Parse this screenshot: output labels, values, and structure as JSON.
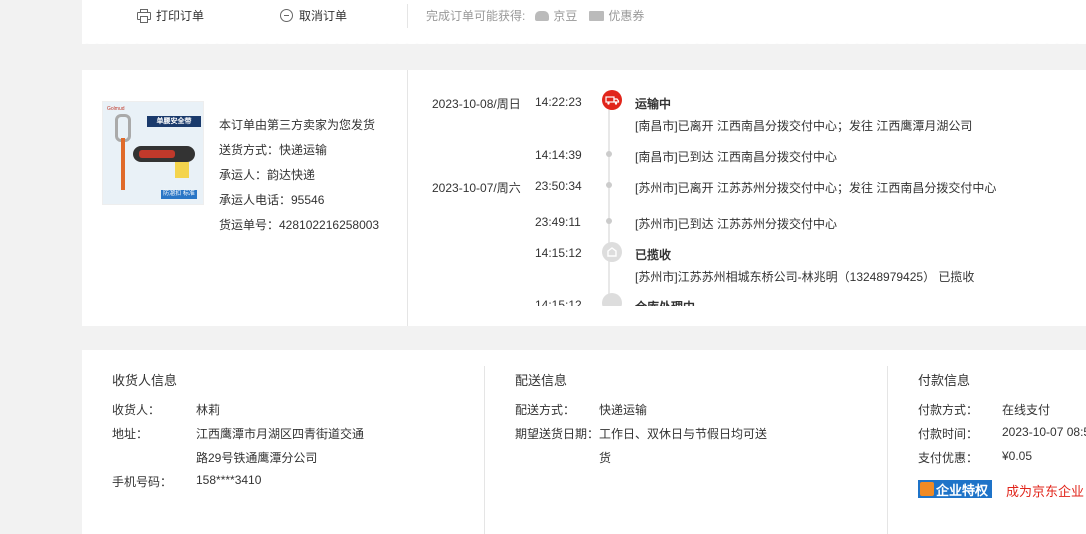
{
  "actions": {
    "print_label": "打印订单",
    "cancel_label": "取消订单",
    "reward_prefix": "完成订单可能获得:",
    "reward_jingdou": "京豆",
    "reward_coupon": "优惠券"
  },
  "package": {
    "image_header": "单腰安全带",
    "image_badge": "防溜扣 标准",
    "image_logo": "Golmud",
    "lines": {
      "seller": "本订单由第三方卖家为您发货",
      "delivery_method": "送货方式：快递运输",
      "carrier": "承运人：韵达快递",
      "carrier_phone": "承运人电话：95546",
      "tracking_no": "货运单号：428102216258003"
    }
  },
  "timeline": {
    "events": [
      {
        "date": "2023-10-08/周日",
        "time": "14:22:23",
        "status": "运输中",
        "text": "[南昌市]已离开 江西南昌分拨交付中心；发往 江西鹰潭月湖公司"
      },
      {
        "date": "",
        "time": "14:14:39",
        "status": "",
        "text": "[南昌市]已到达 江西南昌分拨交付中心"
      },
      {
        "date": "2023-10-07/周六",
        "time": "23:50:34",
        "status": "",
        "text": "[苏州市]已离开 江苏苏州分拨交付中心；发往 江西南昌分拨交付中心"
      },
      {
        "date": "",
        "time": "23:49:11",
        "status": "",
        "text": "[苏州市]已到达 江苏苏州分拨交付中心"
      },
      {
        "date": "",
        "time": "14:15:12",
        "status": "已揽收",
        "text": "[苏州市]江苏苏州相城东桥公司-林兆明（13248979425） 已揽收"
      },
      {
        "date": "",
        "time": "14:15:12",
        "status": "仓库处理中",
        "text": ""
      }
    ]
  },
  "receiver": {
    "title": "收货人信息",
    "name_label": "收货人：",
    "name": "林莉",
    "address_label": "地址：",
    "address_line1": "江西鹰潭市月湖区四青街道交通",
    "address_line2": "路29号铁通鹰潭分公司",
    "phone_label": "手机号码：",
    "phone": "158****3410"
  },
  "delivery": {
    "title": "配送信息",
    "method_label": "配送方式：",
    "method": "快递运输",
    "date_label": "期望送货日期：",
    "date_line1": "工作日、双休日与节假日均可送",
    "date_line2": "货"
  },
  "payment": {
    "title": "付款信息",
    "method_label": "付款方式：",
    "method": "在线支付",
    "time_label": "付款时间：",
    "time": "2023-10-07 08:5",
    "discount_label": "支付优惠：",
    "discount": "¥0.05",
    "enterprise_badge": "企业特权",
    "enterprise_link": "成为京东企业"
  },
  "colors": {
    "accent_red": "#e1251b",
    "enterprise_blue": "#1e73c8"
  }
}
